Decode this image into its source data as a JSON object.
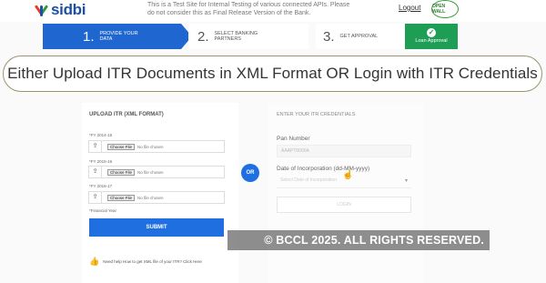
{
  "header": {
    "logo_text": "sidbi",
    "notice": "This is a Test Site for Internal Testing of various connected APIs. Please do not consider this as Final Release Version of the Bank.",
    "logout_label": "Logout",
    "badge_text": "OPEN WALL"
  },
  "steps": [
    {
      "num": "1.",
      "label": "PROVIDE YOUR DATA"
    },
    {
      "num": "2.",
      "label": "SELECT BANKING PARTNERS"
    },
    {
      "num": "3.",
      "label": "GET APPROVAL"
    },
    {
      "check": "✓",
      "label": "Loan Approval"
    }
  ],
  "banner": "Either Upload ITR Documents in XML Format OR Login with ITR Credentials",
  "upload": {
    "title": "UPLOAD ITR (XML FORMAT)",
    "rows": [
      {
        "fy": "*FY 2014-15",
        "choose": "Choose File",
        "nofile": "No file chosen"
      },
      {
        "fy": "*FY 2015-16",
        "choose": "Choose File",
        "nofile": "No file chosen"
      },
      {
        "fy": "*FY 2016-17",
        "choose": "Choose File",
        "nofile": "No file chosen"
      }
    ],
    "fin_note": "*Financial Year",
    "submit_label": "SUBMIT",
    "help_text": "Need help How to get XML file of your ITR? Click Here"
  },
  "or_label": "OR",
  "credentials": {
    "title": "ENTER YOUR ITR CREDENTIALS",
    "pan_label": "Pan Number",
    "pan_placeholder": "AAAPT0000A",
    "doi_label": "Date of Incorporation (dd-MM-yyyy)",
    "doi_placeholder": "Select Date of Incorporation",
    "login_label": "LOGIN"
  },
  "watermark": "© BCCL 2025. ALL RIGHTS RESERVED.",
  "colors": {
    "primary": "#1f66d1",
    "success": "#1e9e55",
    "logo": "#1d4fa3"
  }
}
